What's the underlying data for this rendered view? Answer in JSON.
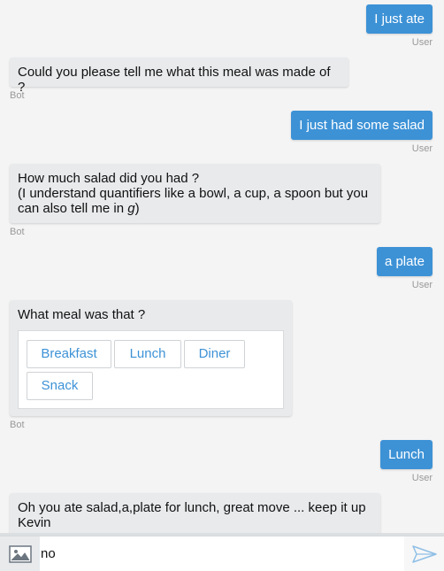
{
  "messages": [
    {
      "text": "I just ate",
      "sender": "User"
    },
    {
      "text": "Could you please tell me what this meal was made of ?",
      "sender": "Bot"
    },
    {
      "text": "I just had some salad",
      "sender": "User"
    },
    {
      "line1": "How much salad did you had ?",
      "line2": "(I understand quantifiers like a bowl, a cup, a spoon but you",
      "line3_pre": "can also tell me in ",
      "line3_em": "g",
      "line3_post": ")",
      "sender": "Bot"
    },
    {
      "text": "a plate",
      "sender": "User"
    },
    {
      "text": "What meal was that ?",
      "sender": "Bot",
      "choices": [
        "Breakfast",
        "Lunch",
        "Diner",
        "Snack"
      ]
    },
    {
      "text": "Lunch",
      "sender": "User"
    },
    {
      "line1": "Oh you ate salad,a,plate for lunch, great move ... keep it up",
      "line2": "Kevin"
    }
  ],
  "input": {
    "value": "no"
  },
  "icons": {
    "image": "image-icon",
    "send": "send-icon"
  },
  "colors": {
    "accent": "#3d92d6",
    "bot_bubble": "#e8eaec"
  }
}
